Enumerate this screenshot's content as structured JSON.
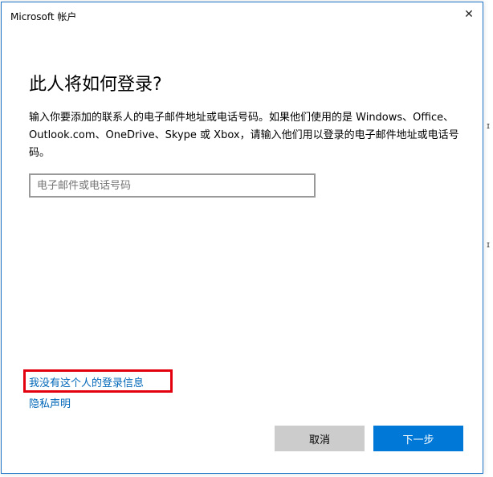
{
  "window": {
    "title": "Microsoft 帐户",
    "close_glyph": "✕"
  },
  "main": {
    "heading": "此人将如何登录?",
    "description": "输入你要添加的联系人的电子邮件地址或电话号码。如果他们使用的是 Windows、Office、Outlook.com、OneDrive、Skype 或 Xbox，请输入他们用以登录的电子邮件地址或电话号码。",
    "email_input": {
      "value": "",
      "placeholder": "电子邮件或电话号码"
    }
  },
  "links": {
    "no_signin_info": "我没有这个人的登录信息",
    "privacy": "隐私声明"
  },
  "buttons": {
    "cancel": "取消",
    "next": "下一步"
  },
  "colors": {
    "accent": "#0078d7",
    "link": "#0067b8",
    "highlight_box": "#e3000f",
    "cancel_bg": "#cccccc"
  }
}
